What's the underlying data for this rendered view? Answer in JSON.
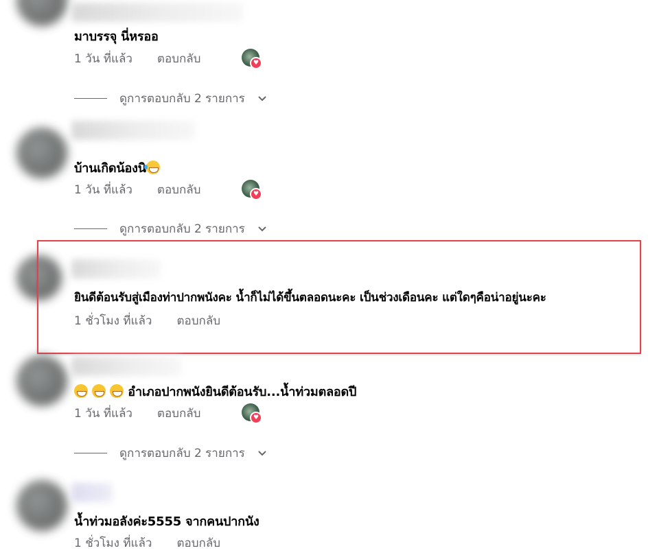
{
  "comments": [
    {
      "text": "มาบรรจุ นี่หรออ",
      "time": "1 วัน ที่แล้ว",
      "reply_label": "ตอบกลับ",
      "has_reaction": true,
      "view_replies": "ดูการตอบกลับ 2 รายการ"
    },
    {
      "text": "บ้านเกิดน้องนิ",
      "emoji_after": "laughing-tears-emoji",
      "time": "1 วัน ที่แล้ว",
      "reply_label": "ตอบกลับ",
      "has_reaction": true,
      "view_replies": "ดูการตอบกลับ 2 รายการ"
    },
    {
      "text": "ยินดีต้อนรับสู่เมืองท่าปากพนังคะ น้ำก็ไม่ได้ขึ้นตลอดนะคะ เป็นช่วงเดือนคะ แต่ใดๆคือน่าอยู่นะคะ",
      "time": "1 ชั่วโมง ที่แล้ว",
      "reply_label": "ตอบกลับ",
      "highlighted": true
    },
    {
      "emoji_before": [
        "grinning-emoji",
        "grinning-emoji",
        "grinning-emoji"
      ],
      "text": "อำเภอปากพนังยินดีต้อนรับ...น้ำท่วมตลอดปี",
      "time": "1 วัน ที่แล้ว",
      "reply_label": "ตอบกลับ",
      "has_reaction": true,
      "view_replies": "ดูการตอบกลับ 2 รายการ"
    },
    {
      "text": "น้ำท่วมอลังค่ะ5555 จากคนปากนัง",
      "time": "1 ชั่วโมง ที่แล้ว",
      "reply_label": "ตอบกลับ"
    }
  ],
  "colors": {
    "highlight_border": "#e5414a",
    "meta_text": "#65676b",
    "heart_reaction": "#f33e58"
  }
}
